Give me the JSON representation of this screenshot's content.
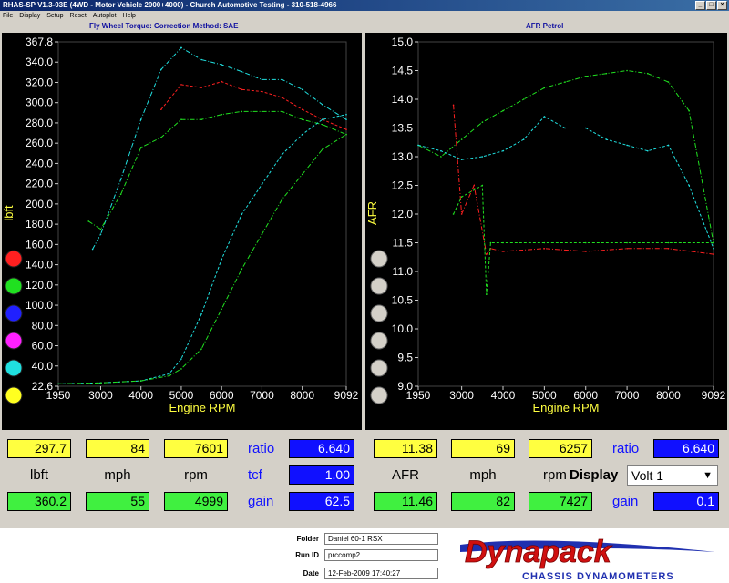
{
  "window": {
    "title": "RHAS-SP V1.3-03E  (4WD - Motor Vehicle 2000+4000) - Church Automotive Testing - 310-518-4966",
    "controls": [
      "_",
      "□",
      "×"
    ]
  },
  "menu": [
    "File",
    "Display",
    "Setup",
    "Reset",
    "Autoplot",
    "Help"
  ],
  "left_panel": {
    "title": "Fly Wheel Torque:        Correction Method: SAE",
    "ylabel": "lbft",
    "xlabel": "Engine RPM",
    "yticks": [
      "367.8",
      "340.0",
      "320.0",
      "300.0",
      "280.0",
      "260.0",
      "240.0",
      "220.0",
      "200.0",
      "180.0",
      "160.0",
      "140.0",
      "120.0",
      "100.0",
      "80.0",
      "60.0",
      "40.0",
      "22.6"
    ],
    "xticks": [
      "1950",
      "3000",
      "4000",
      "5000",
      "6000",
      "7000",
      "8000",
      "9092"
    ],
    "color_dots": [
      "#ff2020",
      "#20e020",
      "#2020ff",
      "#ff20ff",
      "#20e0e0",
      "#ffff20"
    ]
  },
  "right_panel": {
    "title": "AFR Petrol",
    "ylabel": "AFR",
    "xlabel": "Engine RPM",
    "yticks": [
      "15.0",
      "14.5",
      "14.0",
      "13.5",
      "13.0",
      "12.5",
      "12.0",
      "11.5",
      "11.0",
      "10.5",
      "10.0",
      "9.5",
      "9.0"
    ],
    "xticks": [
      "1950",
      "3000",
      "4000",
      "5000",
      "6000",
      "7000",
      "8000",
      "9092"
    ]
  },
  "chart_data": [
    {
      "type": "line",
      "xlim": [
        1950,
        9092
      ],
      "ylim": [
        22.6,
        367.8
      ],
      "ylabel": "lbft",
      "xlabel": "Engine RPM",
      "series": [
        {
          "color": "#20e0e0",
          "x": [
            2800,
            3000,
            3500,
            4000,
            4500,
            5000,
            5500,
            6000,
            6500,
            7000,
            7500,
            8000,
            8500,
            9092
          ],
          "y": [
            160,
            175,
            230,
            290,
            340,
            362,
            350,
            345,
            338,
            330,
            330,
            320,
            305,
            290
          ]
        },
        {
          "color": "#ff2020",
          "x": [
            4500,
            5000,
            5500,
            6000,
            6500,
            7000,
            7500,
            8000,
            8500,
            9092
          ],
          "y": [
            300,
            325,
            322,
            328,
            320,
            318,
            312,
            300,
            290,
            280
          ]
        },
        {
          "color": "#20e020",
          "x": [
            2700,
            3000,
            3500,
            4000,
            4500,
            5000,
            5500,
            6000,
            6500,
            7000,
            7500,
            8000,
            8500,
            9092
          ],
          "y": [
            188,
            180,
            215,
            262,
            272,
            290,
            290,
            295,
            298,
            298,
            298,
            290,
            285,
            275
          ]
        },
        {
          "color": "#20e0e0",
          "x": [
            1950,
            3000,
            4000,
            4700,
            5000,
            5500,
            6000,
            6500,
            7000,
            7500,
            8000,
            8500,
            9092
          ],
          "y": [
            25,
            26,
            28,
            35,
            50,
            95,
            150,
            195,
            225,
            255,
            275,
            290,
            295
          ]
        },
        {
          "color": "#20e020",
          "x": [
            1950,
            3000,
            4000,
            4700,
            5000,
            5500,
            6000,
            6500,
            7000,
            7500,
            8000,
            8500,
            9092
          ],
          "y": [
            25,
            26,
            28,
            33,
            40,
            60,
            100,
            140,
            175,
            210,
            235,
            260,
            275
          ]
        }
      ]
    },
    {
      "type": "line",
      "xlim": [
        1950,
        9092
      ],
      "ylim": [
        9.0,
        15.0
      ],
      "ylabel": "AFR",
      "xlabel": "Engine RPM",
      "series": [
        {
          "color": "#20e020",
          "x": [
            1950,
            2500,
            3000,
            3500,
            4000,
            4500,
            5000,
            5500,
            6000,
            6500,
            7000,
            7500,
            8000,
            8500,
            9092
          ],
          "y": [
            13.2,
            13.0,
            13.3,
            13.6,
            13.8,
            14.0,
            14.2,
            14.3,
            14.4,
            14.45,
            14.5,
            14.45,
            14.3,
            13.8,
            11.5
          ]
        },
        {
          "color": "#20e0e0",
          "x": [
            1950,
            2500,
            3000,
            3500,
            4000,
            4500,
            5000,
            5500,
            6000,
            6500,
            7000,
            7500,
            8000,
            8500,
            9092
          ],
          "y": [
            13.2,
            13.1,
            12.95,
            13.0,
            13.1,
            13.3,
            13.7,
            13.5,
            13.5,
            13.3,
            13.2,
            13.1,
            13.2,
            12.5,
            11.4
          ]
        },
        {
          "color": "#ff2020",
          "x": [
            2800,
            3000,
            3300,
            3600,
            3700,
            4000,
            5000,
            6000,
            7000,
            8000,
            9092
          ],
          "y": [
            13.9,
            12.0,
            12.5,
            11.3,
            11.4,
            11.35,
            11.4,
            11.35,
            11.4,
            11.4,
            11.3
          ]
        },
        {
          "color": "#20e020",
          "x": [
            2800,
            3000,
            3500,
            3600,
            3700,
            4000,
            5000,
            6000,
            7000,
            8000,
            9092
          ],
          "y": [
            12.0,
            12.3,
            12.5,
            10.6,
            11.5,
            11.5,
            11.5,
            11.5,
            11.5,
            11.5,
            11.5
          ]
        }
      ]
    }
  ],
  "left_readout": {
    "row1": [
      "297.7",
      "84",
      "7601"
    ],
    "row2": [
      "lbft",
      "mph",
      "rpm"
    ],
    "row3": [
      "360.2",
      "55",
      "4999"
    ],
    "ratio_label": "ratio",
    "ratio_value": "6.640",
    "tcf_label": "tcf",
    "tcf_value": "1.00",
    "gain_label": "gain",
    "gain_value": "62.5"
  },
  "right_readout": {
    "row1": [
      "11.38",
      "69",
      "6257"
    ],
    "row2": [
      "AFR",
      "mph",
      "rpm"
    ],
    "row3": [
      "11.46",
      "82",
      "7427"
    ],
    "ratio_label": "ratio",
    "ratio_value": "6.640",
    "display_label": "Display",
    "display_value": "Volt 1",
    "gain_label": "gain",
    "gain_value": "0.1"
  },
  "footer": {
    "folder_label": "Folder",
    "folder_value": "Daniel 60-1 RSX",
    "runid_label": "Run ID",
    "runid_value": "prccomp2",
    "date_label": "Date",
    "date_value": "12-Feb-2009   17:40:27",
    "logo_text": "Dynapack",
    "logo_sub": "CHASSIS DYNAMOMETERS"
  }
}
